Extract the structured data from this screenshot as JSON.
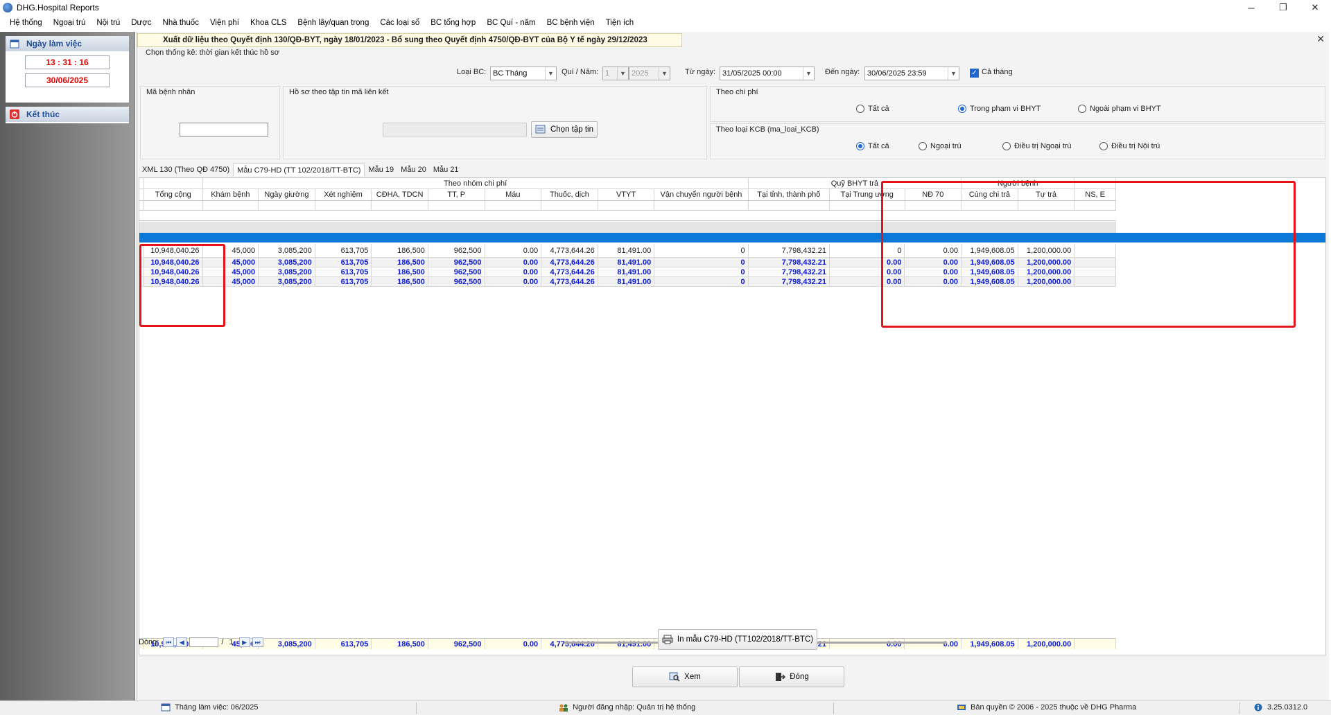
{
  "window": {
    "title": "DHG.Hospital Reports",
    "minimize": "─",
    "maximize": "❐",
    "close": "✕"
  },
  "menu": [
    "Hệ thống",
    "Ngoại trú",
    "Nội trú",
    "Dược",
    "Nhà thuốc",
    "Viện phí",
    "Khoa CLS",
    "Bệnh lây/quan trọng",
    "Các loại sổ",
    "BC tổng hợp",
    "BC Quí - năm",
    "BC bệnh viện",
    "Tiện ích"
  ],
  "left_panel": {
    "workday_title": "Ngày làm việc",
    "time": "13 : 31 : 16",
    "date": "30/06/2025",
    "end_label": "Kết thúc"
  },
  "header": {
    "title": "Xuất dữ liệu theo Quyết định 130/QĐ-BYT, ngày 18/01/2023 - Bổ sung theo Quyết định 4750/QĐ-BYT của Bộ Y tế ngày 29/12/2023",
    "close": "✕"
  },
  "filters": {
    "stat_by": "Chọn thống kê: thời gian kết thúc hồ sơ",
    "report_type_label": "Loại BC:",
    "report_type": "BC Tháng",
    "quarter_year_label": "Quí / Năm:",
    "quarter": "1",
    "year": "2025",
    "from_label": "Từ ngày:",
    "from": "31/05/2025 00:00",
    "to_label": "Đến ngày:",
    "to": "30/06/2025 23:59",
    "whole_month": "Cả tháng"
  },
  "patient_group": {
    "label": "Mã bệnh nhân"
  },
  "file_group": {
    "label": "Hồ sơ theo tập tin mã liên kết",
    "choose_btn": "Chọn tập tin"
  },
  "cost_group": {
    "label": "Theo chi phí",
    "options": [
      "Tất cả",
      "Trong phạm vi BHYT",
      "Ngoài phạm vi BHYT"
    ],
    "selected": 1
  },
  "kcb_group": {
    "label": "Theo loại KCB (ma_loai_KCB)",
    "options": [
      "Tất cả",
      "Ngoại trú",
      "Điều trị Ngoại trú",
      "Điều trị Nội trú"
    ],
    "selected": 0
  },
  "tabs": [
    "XML 130 (Theo QĐ 4750)",
    "Mẫu C79-HD (TT 102/2018/TT-BTC)",
    "Mẫu 19",
    "Mẫu 20",
    "Mẫu 21"
  ],
  "active_tab": 1,
  "grid": {
    "group_headers": {
      "cost_group": "Theo nhóm chi phí",
      "fund": "Quỹ BHYT trả",
      "patient": "Người bệnh"
    },
    "columns": [
      "Tổng cộng",
      "Khám bệnh",
      "Ngày giường",
      "Xét nghiệm",
      "CĐHA, TDCN",
      "TT, P",
      "Máu",
      "Thuốc, dịch",
      "VTYT",
      "Vận chuyển người bệnh",
      "Tại tỉnh, thành phố",
      "Tại Trung ương",
      "NĐ 70",
      "Cùng chi trả",
      "Tự trả",
      "NS, E"
    ],
    "rows": [
      [
        "10,948,040.26",
        "45,000",
        "3,085,200",
        "613,705",
        "186,500",
        "962,500",
        "0.00",
        "4,773,644.26",
        "81,491.00",
        "0",
        "7,798,432.21",
        "0",
        "0.00",
        "1,949,608.05",
        "1,200,000.00",
        ""
      ],
      [
        "10,948,040.26",
        "45,000",
        "3,085,200",
        "613,705",
        "186,500",
        "962,500",
        "0.00",
        "4,773,644.26",
        "81,491.00",
        "0",
        "7,798,432.21",
        "0.00",
        "0.00",
        "1,949,608.05",
        "1,200,000.00",
        ""
      ],
      [
        "10,948,040.26",
        "45,000",
        "3,085,200",
        "613,705",
        "186,500",
        "962,500",
        "0.00",
        "4,773,644.26",
        "81,491.00",
        "0",
        "7,798,432.21",
        "0.00",
        "0.00",
        "1,949,608.05",
        "1,200,000.00",
        ""
      ],
      [
        "10,948,040.26",
        "45,000",
        "3,085,200",
        "613,705",
        "186,500",
        "962,500",
        "0.00",
        "4,773,644.26",
        "81,491.00",
        "0",
        "7,798,432.21",
        "0.00",
        "0.00",
        "1,949,608.05",
        "1,200,000.00",
        ""
      ]
    ],
    "footer": [
      "10,948,040.26",
      "45,000",
      "3,085,200",
      "613,705",
      "186,500",
      "962,500",
      "0.00",
      "4,773,644.26",
      "81,491.00",
      "0",
      "7,798,432.21",
      "0.00",
      "0.00",
      "1,949,608.05",
      "1,200,000.00",
      ""
    ]
  },
  "pager": {
    "label": "Dòng:",
    "sep": "/",
    "total": "1"
  },
  "buttons": {
    "print": "In mẫu C79-HD (TT102/2018/TT-BTC)",
    "view": "Xem",
    "close": "Đóng"
  },
  "status": {
    "month": "Tháng làm việc: 06/2025",
    "user": "Người đăng nhập: Quản trị hệ thống",
    "copyright": "Bản quyền © 2006 - 2025 thuộc về DHG Pharma",
    "version": "3.25.0312.0"
  },
  "colors": {
    "accent": "#1e66d0",
    "selected_row": "#0a78d7",
    "total_text": "#0a19d6",
    "highlight_box": "#e4141b",
    "header_bg": "#fffbe5"
  }
}
